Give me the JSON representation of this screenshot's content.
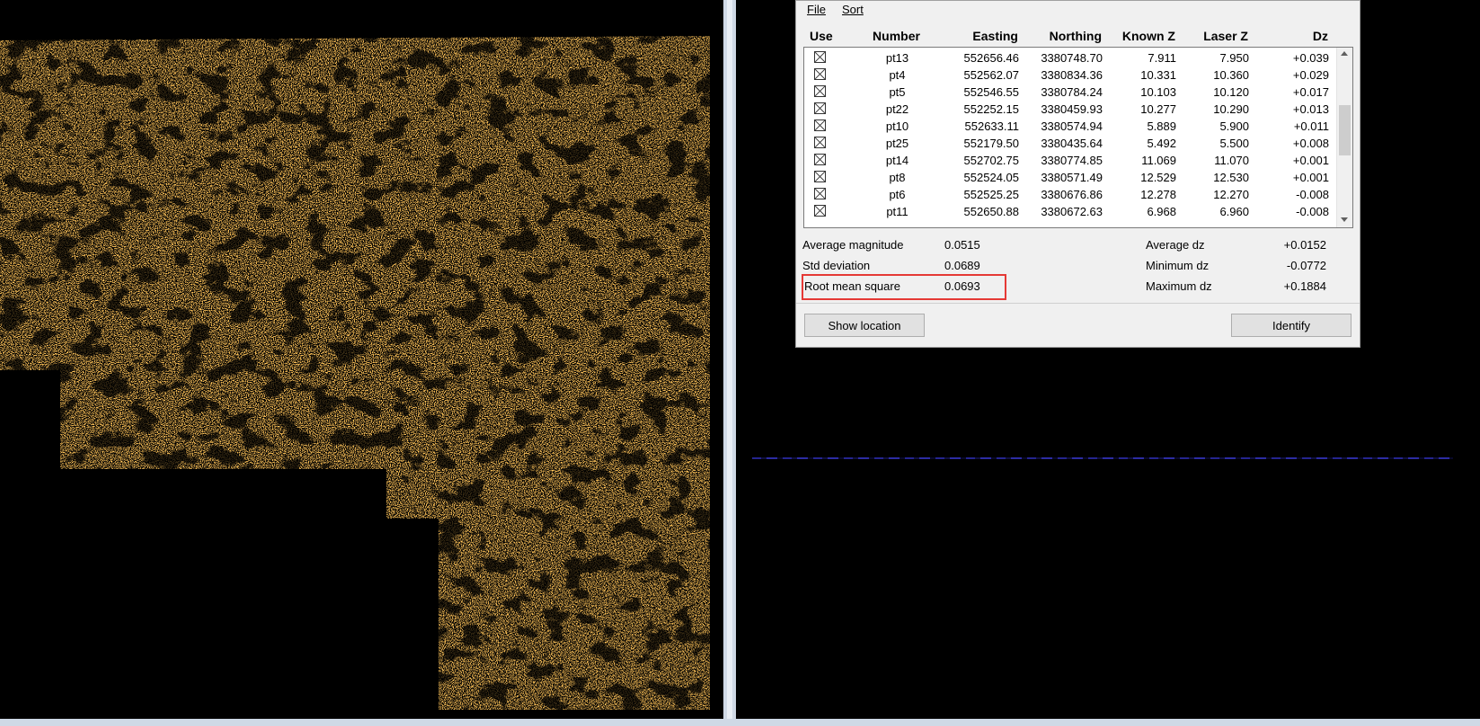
{
  "menu": {
    "file": "File",
    "sort": "Sort"
  },
  "table": {
    "headers": {
      "use": "Use",
      "number": "Number",
      "easting": "Easting",
      "northing": "Northing",
      "known_z": "Known Z",
      "laser_z": "Laser Z",
      "dz": "Dz"
    },
    "rows": [
      {
        "number": "pt13",
        "easting": "552656.46",
        "northing": "3380748.70",
        "known_z": "7.911",
        "laser_z": "7.950",
        "dz": "+0.039"
      },
      {
        "number": "pt4",
        "easting": "552562.07",
        "northing": "3380834.36",
        "known_z": "10.331",
        "laser_z": "10.360",
        "dz": "+0.029"
      },
      {
        "number": "pt5",
        "easting": "552546.55",
        "northing": "3380784.24",
        "known_z": "10.103",
        "laser_z": "10.120",
        "dz": "+0.017"
      },
      {
        "number": "pt22",
        "easting": "552252.15",
        "northing": "3380459.93",
        "known_z": "10.277",
        "laser_z": "10.290",
        "dz": "+0.013"
      },
      {
        "number": "pt10",
        "easting": "552633.11",
        "northing": "3380574.94",
        "known_z": "5.889",
        "laser_z": "5.900",
        "dz": "+0.011"
      },
      {
        "number": "pt25",
        "easting": "552179.50",
        "northing": "3380435.64",
        "known_z": "5.492",
        "laser_z": "5.500",
        "dz": "+0.008"
      },
      {
        "number": "pt14",
        "easting": "552702.75",
        "northing": "3380774.85",
        "known_z": "11.069",
        "laser_z": "11.070",
        "dz": "+0.001"
      },
      {
        "number": "pt8",
        "easting": "552524.05",
        "northing": "3380571.49",
        "known_z": "12.529",
        "laser_z": "12.530",
        "dz": "+0.001"
      },
      {
        "number": "pt6",
        "easting": "552525.25",
        "northing": "3380676.86",
        "known_z": "12.278",
        "laser_z": "12.270",
        "dz": "-0.008"
      },
      {
        "number": "pt11",
        "easting": "552650.88",
        "northing": "3380672.63",
        "known_z": "6.968",
        "laser_z": "6.960",
        "dz": "-0.008"
      }
    ]
  },
  "stats": {
    "avg_magnitude_label": "Average magnitude",
    "avg_magnitude_value": "0.0515",
    "std_label": "Std deviation",
    "std_value": "0.0689",
    "rms_label": "Root mean square",
    "rms_value": "0.0693",
    "avg_dz_label": "Average dz",
    "avg_dz_value": "+0.0152",
    "min_dz_label": "Minimum dz",
    "min_dz_value": "-0.0772",
    "max_dz_label": "Maximum dz",
    "max_dz_value": "+0.1884"
  },
  "buttons": {
    "show_location": "Show location",
    "identify": "Identify"
  },
  "colors": {
    "point_cloud": "#ff8c1a",
    "highlight": "#e53935",
    "profile_line": "#2a2aa8"
  }
}
